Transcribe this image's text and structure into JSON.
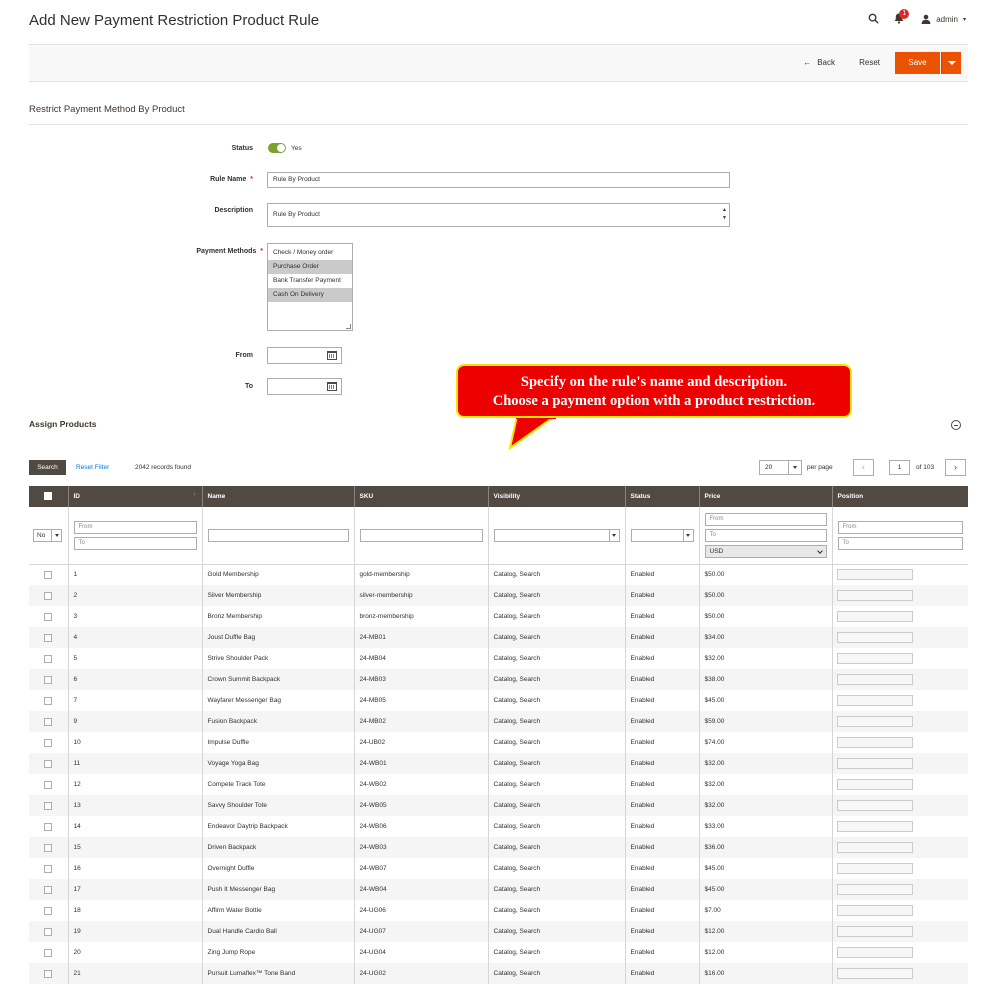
{
  "header": {
    "title": "Add New Payment Restriction Product Rule",
    "notification_count": "1",
    "user": "admin"
  },
  "actions": {
    "back": "Back",
    "reset": "Reset",
    "save": "Save"
  },
  "section": {
    "title": "Restrict Payment Method By Product"
  },
  "form": {
    "status_label": "Status",
    "status_value": "Yes",
    "rule_name_label": "Rule Name",
    "rule_name_value": "Rule By Product",
    "description_label": "Description",
    "description_value": "Rule By Product",
    "payment_methods_label": "Payment Methods",
    "payment_methods": [
      {
        "label": "Check / Money order",
        "selected": false
      },
      {
        "label": "Purchase Order",
        "selected": true
      },
      {
        "label": "Bank Transfer Payment",
        "selected": false
      },
      {
        "label": "Cash On Delivery",
        "selected": true
      }
    ],
    "from_label": "From",
    "to_label": "To",
    "required_mark": "*"
  },
  "callout": {
    "line1": "Specify on the rule's name and description.",
    "line2": "Choose a payment option with a product restriction.",
    "colors": {
      "fill": "#ec0000",
      "border": "#f6e600"
    }
  },
  "assign": {
    "title": "Assign Products",
    "search_button": "Search",
    "reset_filter": "Reset Filter",
    "records_found": "2042 records found",
    "per_page_value": "20",
    "per_page_label": "per page",
    "current_page": "1",
    "total_pages": "of 103"
  },
  "grid": {
    "columns": [
      "ID",
      "Name",
      "SKU",
      "Visibility",
      "Status",
      "Price",
      "Position"
    ],
    "filters": {
      "in_products": "No",
      "from_placeholder": "From",
      "to_placeholder": "To",
      "currency": "USD"
    },
    "rows": [
      {
        "id": "1",
        "name": "Gold Membership",
        "sku": "gold-membership",
        "visibility": "Catalog, Search",
        "status": "Enabled",
        "price": "$50.00"
      },
      {
        "id": "2",
        "name": "Silver Membership",
        "sku": "silver-membership",
        "visibility": "Catalog, Search",
        "status": "Enabled",
        "price": "$50.00"
      },
      {
        "id": "3",
        "name": "Bronz Membership",
        "sku": "bronz-membership",
        "visibility": "Catalog, Search",
        "status": "Enabled",
        "price": "$50.00"
      },
      {
        "id": "4",
        "name": "Joust Duffle Bag",
        "sku": "24-MB01",
        "visibility": "Catalog, Search",
        "status": "Enabled",
        "price": "$34.00"
      },
      {
        "id": "5",
        "name": "Strive Shoulder Pack",
        "sku": "24-MB04",
        "visibility": "Catalog, Search",
        "status": "Enabled",
        "price": "$32.00"
      },
      {
        "id": "6",
        "name": "Crown Summit Backpack",
        "sku": "24-MB03",
        "visibility": "Catalog, Search",
        "status": "Enabled",
        "price": "$38.00"
      },
      {
        "id": "7",
        "name": "Wayfarer Messenger Bag",
        "sku": "24-MB05",
        "visibility": "Catalog, Search",
        "status": "Enabled",
        "price": "$45.00"
      },
      {
        "id": "9",
        "name": "Fusion Backpack",
        "sku": "24-MB02",
        "visibility": "Catalog, Search",
        "status": "Enabled",
        "price": "$59.00"
      },
      {
        "id": "10",
        "name": "Impulse Duffle",
        "sku": "24-UB02",
        "visibility": "Catalog, Search",
        "status": "Enabled",
        "price": "$74.00"
      },
      {
        "id": "11",
        "name": "Voyage Yoga Bag",
        "sku": "24-WB01",
        "visibility": "Catalog, Search",
        "status": "Enabled",
        "price": "$32.00"
      },
      {
        "id": "12",
        "name": "Compete Track Tote",
        "sku": "24-WB02",
        "visibility": "Catalog, Search",
        "status": "Enabled",
        "price": "$32.00"
      },
      {
        "id": "13",
        "name": "Savvy Shoulder Tote",
        "sku": "24-WB05",
        "visibility": "Catalog, Search",
        "status": "Enabled",
        "price": "$32.00"
      },
      {
        "id": "14",
        "name": "Endeavor Daytrip Backpack",
        "sku": "24-WB06",
        "visibility": "Catalog, Search",
        "status": "Enabled",
        "price": "$33.00"
      },
      {
        "id": "15",
        "name": "Driven Backpack",
        "sku": "24-WB03",
        "visibility": "Catalog, Search",
        "status": "Enabled",
        "price": "$36.00"
      },
      {
        "id": "16",
        "name": "Overnight Duffle",
        "sku": "24-WB07",
        "visibility": "Catalog, Search",
        "status": "Enabled",
        "price": "$45.00"
      },
      {
        "id": "17",
        "name": "Push It Messenger Bag",
        "sku": "24-WB04",
        "visibility": "Catalog, Search",
        "status": "Enabled",
        "price": "$45.00"
      },
      {
        "id": "18",
        "name": "Affirm Water Bottle",
        "sku": "24-UG06",
        "visibility": "Catalog, Search",
        "status": "Enabled",
        "price": "$7.00"
      },
      {
        "id": "19",
        "name": "Dual Handle Cardio Ball",
        "sku": "24-UG07",
        "visibility": "Catalog, Search",
        "status": "Enabled",
        "price": "$12.00"
      },
      {
        "id": "20",
        "name": "Zing Jump Rope",
        "sku": "24-UG04",
        "visibility": "Catalog, Search",
        "status": "Enabled",
        "price": "$12.00"
      },
      {
        "id": "21",
        "name": "Pursuit Lumaflex™ Tone Band",
        "sku": "24-UG02",
        "visibility": "Catalog, Search",
        "status": "Enabled",
        "price": "$16.00"
      }
    ]
  },
  "icons": {
    "search": "search-icon",
    "bell": "bell-icon",
    "user": "user-icon",
    "calendar": "calendar-icon",
    "collapse": "collapse-icon"
  },
  "colors": {
    "accent": "#eb5202",
    "grid_header": "#514943",
    "link": "#007bdb",
    "toggle_on": "#79a22e"
  }
}
